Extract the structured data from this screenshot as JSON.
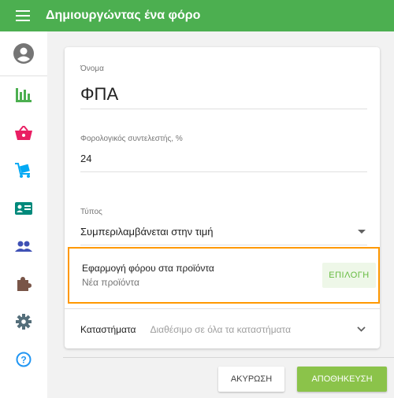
{
  "header": {
    "title": "Δημιουργώντας ένα φόρο"
  },
  "sidebar": {
    "items": [
      {
        "name": "account-icon"
      },
      {
        "name": "chart-icon"
      },
      {
        "name": "basket-icon"
      },
      {
        "name": "cart-icon"
      },
      {
        "name": "id-card-icon"
      },
      {
        "name": "people-icon"
      },
      {
        "name": "puzzle-icon"
      },
      {
        "name": "gear-icon"
      },
      {
        "name": "help-icon"
      }
    ]
  },
  "form": {
    "name_label": "Όνομα",
    "name_value": "ΦΠΑ",
    "rate_label": "Φορολογικός συντελεστής, %",
    "rate_value": "24",
    "type_label": "Τύπος",
    "type_value": "Συμπεριλαμβάνεται στην τιμή",
    "apply_title": "Εφαρμογή φόρου στα προϊόντα",
    "apply_subtitle": "Νέα προϊόντα",
    "apply_button": "ΕΠΙΛΟΓΗ",
    "stores_label": "Καταστήματα",
    "stores_value": "Διαθέσιμο σε όλα τα καταστήματα"
  },
  "actions": {
    "cancel": "ΑΚΥΡΩΣΗ",
    "save": "ΑΠΟΘΗΚΕΥΣΗ"
  },
  "colors": {
    "primary": "#4caf50",
    "highlight": "#ff9800",
    "accent_green": "#8bc34a"
  }
}
